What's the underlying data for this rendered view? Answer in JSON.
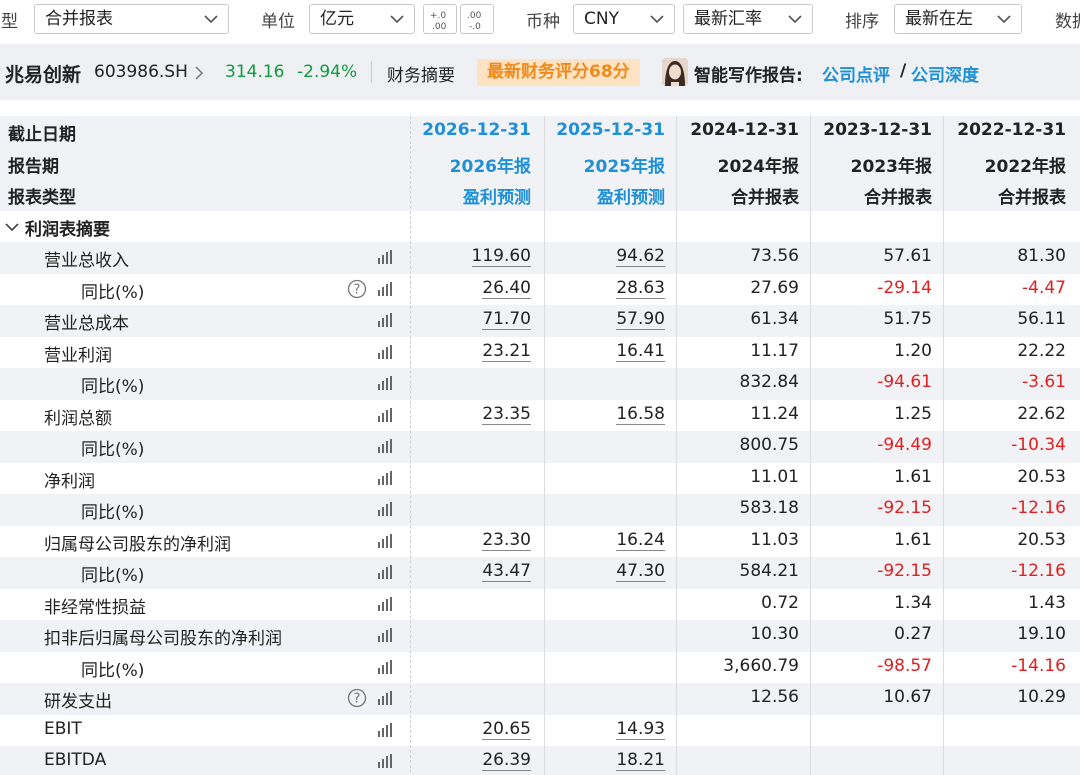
{
  "toolbar": {
    "type_label": "类型",
    "type_value": "合并报表",
    "unit_label": "单位",
    "unit_value": "亿元",
    "currency_label": "币种",
    "currency_value": "CNY",
    "rate_value": "最新汇率",
    "sort_label": "排序",
    "sort_value": "最新在左",
    "data_label": "数据"
  },
  "stock": {
    "name": "兆易创新",
    "code": "603986.SH",
    "price": "314.16",
    "change": "-2.94%",
    "summary": "财务摘要",
    "score": "最新财务评分68分",
    "ai_label": "智能写作报告:",
    "link1": "公司点评",
    "sep": "/",
    "link2": "公司深度"
  },
  "colors": {
    "up_green": "#109a3c",
    "neg_red": "#e02020",
    "link_blue": "#1f8fd6",
    "badge_orange": "#f08a1a"
  },
  "headers": {
    "labels": [
      "截止日期",
      "报告期",
      "报表类型"
    ],
    "columns": [
      {
        "date": "2026-12-31",
        "period": "2026年报",
        "type": "盈利预测",
        "forecast": true
      },
      {
        "date": "2025-12-31",
        "period": "2025年报",
        "type": "盈利预测",
        "forecast": true
      },
      {
        "date": "2024-12-31",
        "period": "2024年报",
        "type": "合并报表",
        "forecast": false
      },
      {
        "date": "2023-12-31",
        "period": "2023年报",
        "type": "合并报表",
        "forecast": false
      },
      {
        "date": "2022-12-31",
        "period": "2022年报",
        "type": "合并报表",
        "forecast": false
      }
    ]
  },
  "section": {
    "title": "利润表摘要"
  },
  "rows": [
    {
      "label": "营业总收入",
      "indent": 1,
      "help": false,
      "values": [
        "119.60",
        "94.62",
        "73.56",
        "57.61",
        "81.30"
      ]
    },
    {
      "label": "同比(%)",
      "indent": 2,
      "help": true,
      "values": [
        "26.40",
        "28.63",
        "27.69",
        "-29.14",
        "-4.47"
      ]
    },
    {
      "label": "营业总成本",
      "indent": 1,
      "help": false,
      "values": [
        "71.70",
        "57.90",
        "61.34",
        "51.75",
        "56.11"
      ]
    },
    {
      "label": "营业利润",
      "indent": 1,
      "help": false,
      "values": [
        "23.21",
        "16.41",
        "11.17",
        "1.20",
        "22.22"
      ]
    },
    {
      "label": "同比(%)",
      "indent": 2,
      "help": false,
      "values": [
        "",
        "",
        "832.84",
        "-94.61",
        "-3.61"
      ]
    },
    {
      "label": "利润总额",
      "indent": 1,
      "help": false,
      "values": [
        "23.35",
        "16.58",
        "11.24",
        "1.25",
        "22.62"
      ]
    },
    {
      "label": "同比(%)",
      "indent": 2,
      "help": false,
      "values": [
        "",
        "",
        "800.75",
        "-94.49",
        "-10.34"
      ]
    },
    {
      "label": "净利润",
      "indent": 1,
      "help": false,
      "values": [
        "",
        "",
        "11.01",
        "1.61",
        "20.53"
      ]
    },
    {
      "label": "同比(%)",
      "indent": 2,
      "help": false,
      "values": [
        "",
        "",
        "583.18",
        "-92.15",
        "-12.16"
      ]
    },
    {
      "label": "归属母公司股东的净利润",
      "indent": 1,
      "help": false,
      "values": [
        "23.30",
        "16.24",
        "11.03",
        "1.61",
        "20.53"
      ]
    },
    {
      "label": "同比(%)",
      "indent": 2,
      "help": false,
      "values": [
        "43.47",
        "47.30",
        "584.21",
        "-92.15",
        "-12.16"
      ]
    },
    {
      "label": "非经常性损益",
      "indent": 1,
      "help": false,
      "values": [
        "",
        "",
        "0.72",
        "1.34",
        "1.43"
      ]
    },
    {
      "label": "扣非后归属母公司股东的净利润",
      "indent": 1,
      "help": false,
      "values": [
        "",
        "",
        "10.30",
        "0.27",
        "19.10"
      ]
    },
    {
      "label": "同比(%)",
      "indent": 2,
      "help": false,
      "values": [
        "",
        "",
        "3,660.79",
        "-98.57",
        "-14.16"
      ]
    },
    {
      "label": "研发支出",
      "indent": 1,
      "help": true,
      "values": [
        "",
        "",
        "12.56",
        "10.67",
        "10.29"
      ]
    },
    {
      "label": "EBIT",
      "indent": 1,
      "help": false,
      "values": [
        "20.65",
        "14.93",
        "",
        "",
        ""
      ]
    },
    {
      "label": "EBITDA",
      "indent": 1,
      "help": false,
      "values": [
        "26.39",
        "18.21",
        "",
        "",
        ""
      ]
    }
  ]
}
